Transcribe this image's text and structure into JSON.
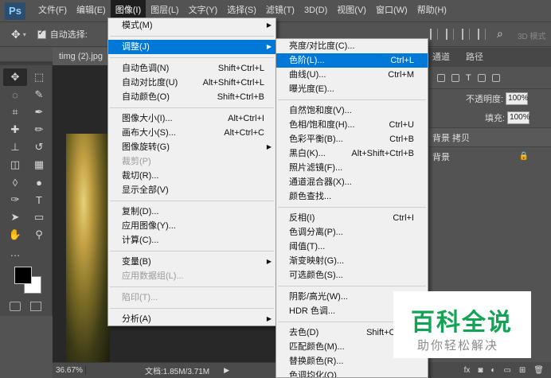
{
  "app": {
    "logo": "Ps"
  },
  "menubar": {
    "items": [
      "文件(F)",
      "编辑(E)",
      "图像(I)",
      "图层(L)",
      "文字(Y)",
      "选择(S)",
      "滤镜(T)",
      "3D(D)",
      "视图(V)",
      "窗口(W)",
      "帮助(H)"
    ],
    "active_index": 2
  },
  "options": {
    "auto_select_label": "自动选择:",
    "mode3d": "3D 模式"
  },
  "document": {
    "tab_title": "timg (2).jpg",
    "zoom": "36.67%",
    "doc_size": "文档:1.85M/3.71M"
  },
  "layers_panel": {
    "tabs": [
      "通道",
      "路径"
    ],
    "opacity_label": "不透明度:",
    "opacity_value": "100%",
    "fill_label": "填充:",
    "fill_value": "100%",
    "layers": [
      {
        "name": "背景 拷贝",
        "selected": true
      },
      {
        "name": "背景",
        "selected": false
      }
    ]
  },
  "image_menu": {
    "items": [
      {
        "label": "模式(M)",
        "shortcut": "",
        "submenu": true,
        "disabled": false,
        "highlighted": false
      },
      {
        "sep": true
      },
      {
        "label": "调整(J)",
        "shortcut": "",
        "submenu": true,
        "disabled": false,
        "highlighted": true
      },
      {
        "sep": true
      },
      {
        "label": "自动色调(N)",
        "shortcut": "Shift+Ctrl+L",
        "submenu": false,
        "disabled": false
      },
      {
        "label": "自动对比度(U)",
        "shortcut": "Alt+Shift+Ctrl+L",
        "submenu": false,
        "disabled": false
      },
      {
        "label": "自动颜色(O)",
        "shortcut": "Shift+Ctrl+B",
        "submenu": false,
        "disabled": false
      },
      {
        "sep": true
      },
      {
        "label": "图像大小(I)...",
        "shortcut": "Alt+Ctrl+I",
        "submenu": false,
        "disabled": false
      },
      {
        "label": "画布大小(S)...",
        "shortcut": "Alt+Ctrl+C",
        "submenu": false,
        "disabled": false
      },
      {
        "label": "图像旋转(G)",
        "shortcut": "",
        "submenu": true,
        "disabled": false
      },
      {
        "label": "裁剪(P)",
        "shortcut": "",
        "submenu": false,
        "disabled": true
      },
      {
        "label": "裁切(R)...",
        "shortcut": "",
        "submenu": false,
        "disabled": false
      },
      {
        "label": "显示全部(V)",
        "shortcut": "",
        "submenu": false,
        "disabled": false
      },
      {
        "sep": true
      },
      {
        "label": "复制(D)...",
        "shortcut": "",
        "submenu": false,
        "disabled": false
      },
      {
        "label": "应用图像(Y)...",
        "shortcut": "",
        "submenu": false,
        "disabled": false
      },
      {
        "label": "计算(C)...",
        "shortcut": "",
        "submenu": false,
        "disabled": false
      },
      {
        "sep": true
      },
      {
        "label": "变量(B)",
        "shortcut": "",
        "submenu": true,
        "disabled": false
      },
      {
        "label": "应用数据组(L)...",
        "shortcut": "",
        "submenu": false,
        "disabled": true
      },
      {
        "sep": true
      },
      {
        "label": "陷印(T)...",
        "shortcut": "",
        "submenu": false,
        "disabled": true
      },
      {
        "sep": true
      },
      {
        "label": "分析(A)",
        "shortcut": "",
        "submenu": true,
        "disabled": false
      }
    ]
  },
  "adjust_menu": {
    "items": [
      {
        "label": "亮度/对比度(C)...",
        "shortcut": ""
      },
      {
        "label": "色阶(L)...",
        "shortcut": "Ctrl+L",
        "highlighted": true
      },
      {
        "label": "曲线(U)...",
        "shortcut": "Ctrl+M"
      },
      {
        "label": "曝光度(E)...",
        "shortcut": ""
      },
      {
        "sep": true
      },
      {
        "label": "自然饱和度(V)...",
        "shortcut": ""
      },
      {
        "label": "色相/饱和度(H)...",
        "shortcut": "Ctrl+U"
      },
      {
        "label": "色彩平衡(B)...",
        "shortcut": "Ctrl+B"
      },
      {
        "label": "黑白(K)...",
        "shortcut": "Alt+Shift+Ctrl+B"
      },
      {
        "label": "照片滤镜(F)...",
        "shortcut": ""
      },
      {
        "label": "通道混合器(X)...",
        "shortcut": ""
      },
      {
        "label": "颜色查找...",
        "shortcut": ""
      },
      {
        "sep": true
      },
      {
        "label": "反相(I)",
        "shortcut": "Ctrl+I"
      },
      {
        "label": "色调分离(P)...",
        "shortcut": ""
      },
      {
        "label": "阈值(T)...",
        "shortcut": ""
      },
      {
        "label": "渐变映射(G)...",
        "shortcut": ""
      },
      {
        "label": "可选颜色(S)...",
        "shortcut": ""
      },
      {
        "sep": true
      },
      {
        "label": "阴影/高光(W)...",
        "shortcut": ""
      },
      {
        "label": "HDR 色调...",
        "shortcut": ""
      },
      {
        "sep": true
      },
      {
        "label": "去色(D)",
        "shortcut": "Shift+Ctrl+U"
      },
      {
        "label": "匹配颜色(M)...",
        "shortcut": ""
      },
      {
        "label": "替换颜色(R)...",
        "shortcut": ""
      },
      {
        "label": "色调均化(Q)",
        "shortcut": ""
      }
    ]
  },
  "watermark": {
    "title": "百科全说",
    "subtitle": "助你轻松解决"
  },
  "colors": {
    "highlight": "#0078d7",
    "watermark_green": "#12a354"
  }
}
